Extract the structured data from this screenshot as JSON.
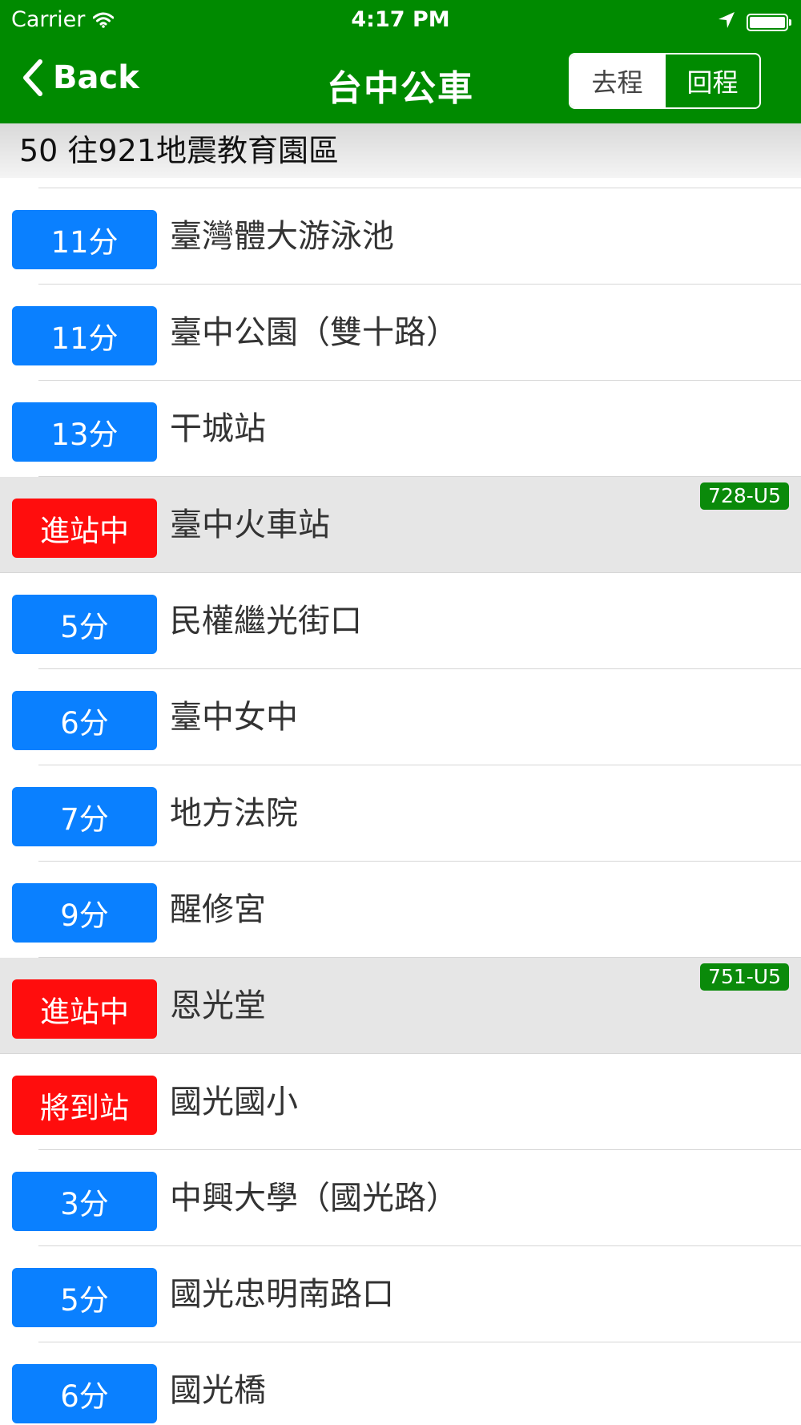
{
  "status_bar": {
    "carrier": "Carrier",
    "time": "4:17 PM"
  },
  "navbar": {
    "back_label": "Back",
    "title": "台中公車",
    "segments": [
      "去程",
      "回程"
    ],
    "selected_segment": "去程"
  },
  "route": {
    "header": "50 往921地震教育園區"
  },
  "colors": {
    "navbar_green": "#008a00",
    "eta_blue": "#0a80ff",
    "arriving_red": "#ff0d0d",
    "bus_tag_green": "#0a8a0a",
    "highlight_row": "#e6e6e6"
  },
  "stops": [
    {
      "eta": "11分",
      "name": "臺灣體大游泳池",
      "status": "eta",
      "bus": ""
    },
    {
      "eta": "11分",
      "name": "臺中公園（雙十路）",
      "status": "eta",
      "bus": ""
    },
    {
      "eta": "13分",
      "name": "干城站",
      "status": "eta",
      "bus": ""
    },
    {
      "eta": "進站中",
      "name": "臺中火車站",
      "status": "arriving",
      "bus": "728-U5"
    },
    {
      "eta": "5分",
      "name": "民權繼光街口",
      "status": "eta",
      "bus": ""
    },
    {
      "eta": "6分",
      "name": "臺中女中",
      "status": "eta",
      "bus": ""
    },
    {
      "eta": "7分",
      "name": "地方法院",
      "status": "eta",
      "bus": ""
    },
    {
      "eta": "9分",
      "name": "醒修宮",
      "status": "eta",
      "bus": ""
    },
    {
      "eta": "進站中",
      "name": "恩光堂",
      "status": "arriving",
      "bus": "751-U5"
    },
    {
      "eta": "將到站",
      "name": "國光國小",
      "status": "arriving",
      "bus": ""
    },
    {
      "eta": "3分",
      "name": "中興大學（國光路）",
      "status": "eta",
      "bus": ""
    },
    {
      "eta": "5分",
      "name": "國光忠明南路口",
      "status": "eta",
      "bus": ""
    },
    {
      "eta": "6分",
      "name": "國光橋",
      "status": "eta",
      "bus": ""
    }
  ]
}
